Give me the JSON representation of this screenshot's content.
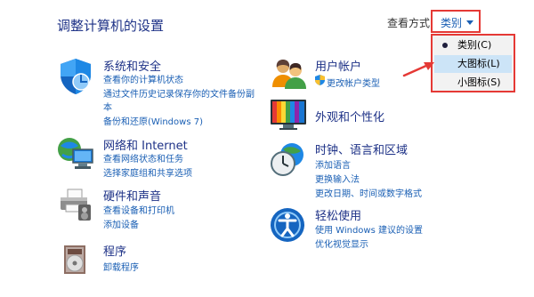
{
  "header": {
    "title": "调整计算机的设置",
    "view_by_label": "查看方式:",
    "view_value": "类别"
  },
  "view_menu": {
    "items": [
      "类别(C)",
      "大图标(L)",
      "小图标(S)"
    ],
    "selected_index": 0,
    "hover_index": 1
  },
  "categories": {
    "system": {
      "title": "系统和安全",
      "links": [
        "查看你的计算机状态",
        "通过文件历史记录保存你的文件备份副",
        "本",
        "备份和还原(Windows 7)"
      ]
    },
    "network": {
      "title": "网络和 Internet",
      "links": [
        "查看网络状态和任务",
        "选择家庭组和共享选项"
      ]
    },
    "hardware": {
      "title": "硬件和声音",
      "links": [
        "查看设备和打印机",
        "添加设备"
      ]
    },
    "programs": {
      "title": "程序",
      "links": [
        "卸载程序"
      ]
    },
    "accounts": {
      "title": "用户帐户",
      "links": [
        "更改帐户类型"
      ]
    },
    "appearance": {
      "title": "外观和个性化",
      "links": []
    },
    "clock": {
      "title": "时钟、语言和区域",
      "links": [
        "添加语言",
        "更换输入法",
        "更改日期、时间或数字格式"
      ]
    },
    "ease": {
      "title": "轻松使用",
      "links": [
        "使用 Windows 建议的设置",
        "优化视觉显示"
      ]
    }
  }
}
